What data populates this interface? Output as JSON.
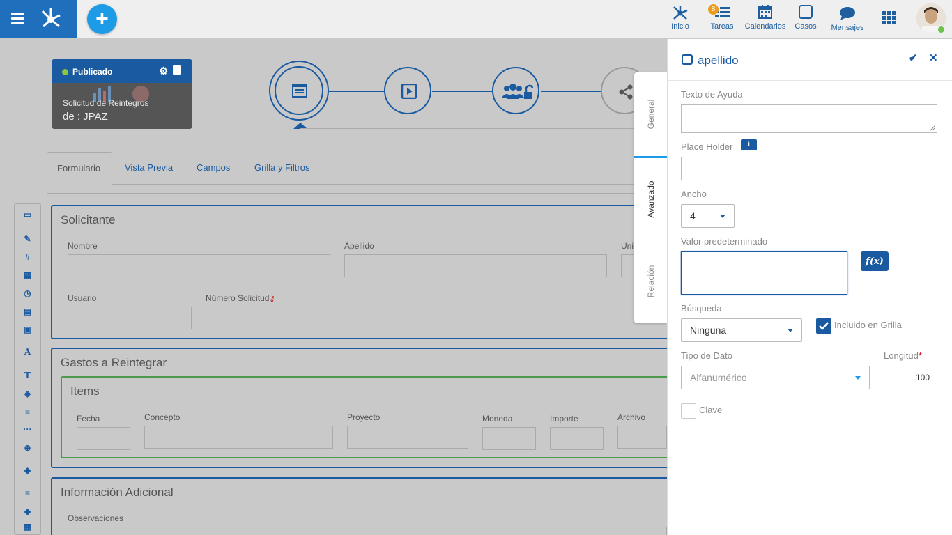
{
  "topbar": {
    "nav": [
      {
        "label": "Inicio",
        "icon": "home-network-icon"
      },
      {
        "label": "Tareas",
        "icon": "tasks-icon",
        "badge": "8"
      },
      {
        "label": "Calendarios",
        "icon": "calendar-icon"
      },
      {
        "label": "Casos",
        "icon": "cases-icon"
      },
      {
        "label": "Mensajes",
        "icon": "message-icon"
      }
    ]
  },
  "process_card": {
    "status": "Publicado",
    "title": "Solicitud de Reintegros",
    "subtitle": "de : JPAZ"
  },
  "editor_tabs": [
    "Formulario",
    "Vista Previa",
    "Campos",
    "Grilla y Filtros"
  ],
  "form": {
    "solicitante": {
      "title": "Solicitante",
      "fields": [
        "Nombre",
        "Apellido",
        "Uni",
        "Usuario",
        "Número Solicitud"
      ]
    },
    "gastos": {
      "title": "Gastos a Reintegrar",
      "items_title": "Items",
      "columns": [
        "Fecha",
        "Concepto",
        "Proyecto",
        "Moneda",
        "Importe",
        "Archivo"
      ]
    },
    "adicional": {
      "title": "Información Adicional",
      "fields": [
        "Observaciones"
      ]
    }
  },
  "vertical_tabs": [
    "General",
    "Avanzado",
    "Relación"
  ],
  "panel": {
    "title": "apellido",
    "help_label": "Texto de Ayuda",
    "placeholder_label": "Place Holder",
    "width_label": "Ancho",
    "width_value": "4",
    "default_label": "Valor predeterminado",
    "fx_label": "f(x)",
    "search_label": "Búsqueda",
    "search_value": "Ninguna",
    "grid_check_label": "Incluido en Grilla",
    "grid_checked": true,
    "datatype_label": "Tipo de Dato",
    "datatype_value": "Alfanumérico",
    "length_label": "Longitud",
    "length_required": "*",
    "length_value": "100",
    "key_label": "Clave",
    "key_checked": false
  },
  "colors": {
    "primary": "#1a5aa0",
    "accent": "#1d9be6",
    "status_green": "#8fc63f",
    "badge_orange": "#f09a1a"
  }
}
